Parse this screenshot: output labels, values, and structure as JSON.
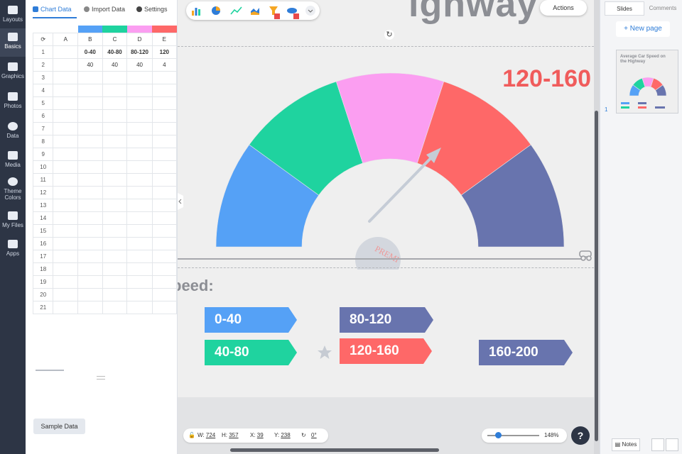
{
  "rail": {
    "items": [
      {
        "label": "Layouts"
      },
      {
        "label": "Basics"
      },
      {
        "label": "Graphics"
      },
      {
        "label": "Photos"
      },
      {
        "label": "Data"
      },
      {
        "label": "Media"
      },
      {
        "label": "Theme Colors"
      },
      {
        "label": "My Files"
      },
      {
        "label": "Apps"
      }
    ]
  },
  "panel": {
    "tabs": [
      {
        "label": "Chart Data"
      },
      {
        "label": "Import Data"
      },
      {
        "label": "Settings"
      }
    ],
    "columns": [
      "A",
      "B",
      "C",
      "D",
      "E"
    ],
    "column_colors": [
      "#55a1f6",
      "#1fd39f",
      "#fb9ef1",
      "#fe6868"
    ],
    "row1": [
      "",
      "0-40",
      "40-80",
      "80-120",
      "120"
    ],
    "row2": [
      "",
      "40",
      "40",
      "40",
      "4"
    ],
    "row_numbers": [
      "1",
      "2",
      "3",
      "4",
      "5",
      "6",
      "7",
      "8",
      "9",
      "10",
      "11",
      "12",
      "13",
      "14",
      "15",
      "16",
      "17",
      "18",
      "19",
      "20",
      "21"
    ],
    "sample_button": "Sample Data"
  },
  "canvas": {
    "title_fragment": "ighway",
    "big_label": "120-160",
    "speed_word": "peed:",
    "watermark": "PREMI",
    "tags": [
      {
        "label": "0-40",
        "color": "#55a1f6"
      },
      {
        "label": "40-80",
        "color": "#1fd39f"
      },
      {
        "label": "80-120",
        "color": "#6874ae"
      },
      {
        "label": "120-160",
        "color": "#fe6868"
      },
      {
        "label": "160-200",
        "color": "#6874ae"
      }
    ],
    "gauge_colors": [
      "#55a1f6",
      "#1fd39f",
      "#fb9ef1",
      "#fe6868",
      "#6874ae"
    ],
    "actions_label": "Actions"
  },
  "status": {
    "w_label": "W:",
    "w_value": "724",
    "h_label": "H:",
    "h_value": "357",
    "x_label": "X:",
    "x_value": "39",
    "y_label": "Y:",
    "y_value": "238",
    "rotation": "0°",
    "zoom": "148%",
    "zoom_level": 0.2
  },
  "sidebar": {
    "tab_slides": "Slides",
    "tab_comments": "Comments",
    "new_page": "+ New page",
    "thumb_title": "Average Car Speed on the Highway",
    "thumb_number": "1",
    "notes": "Notes"
  }
}
